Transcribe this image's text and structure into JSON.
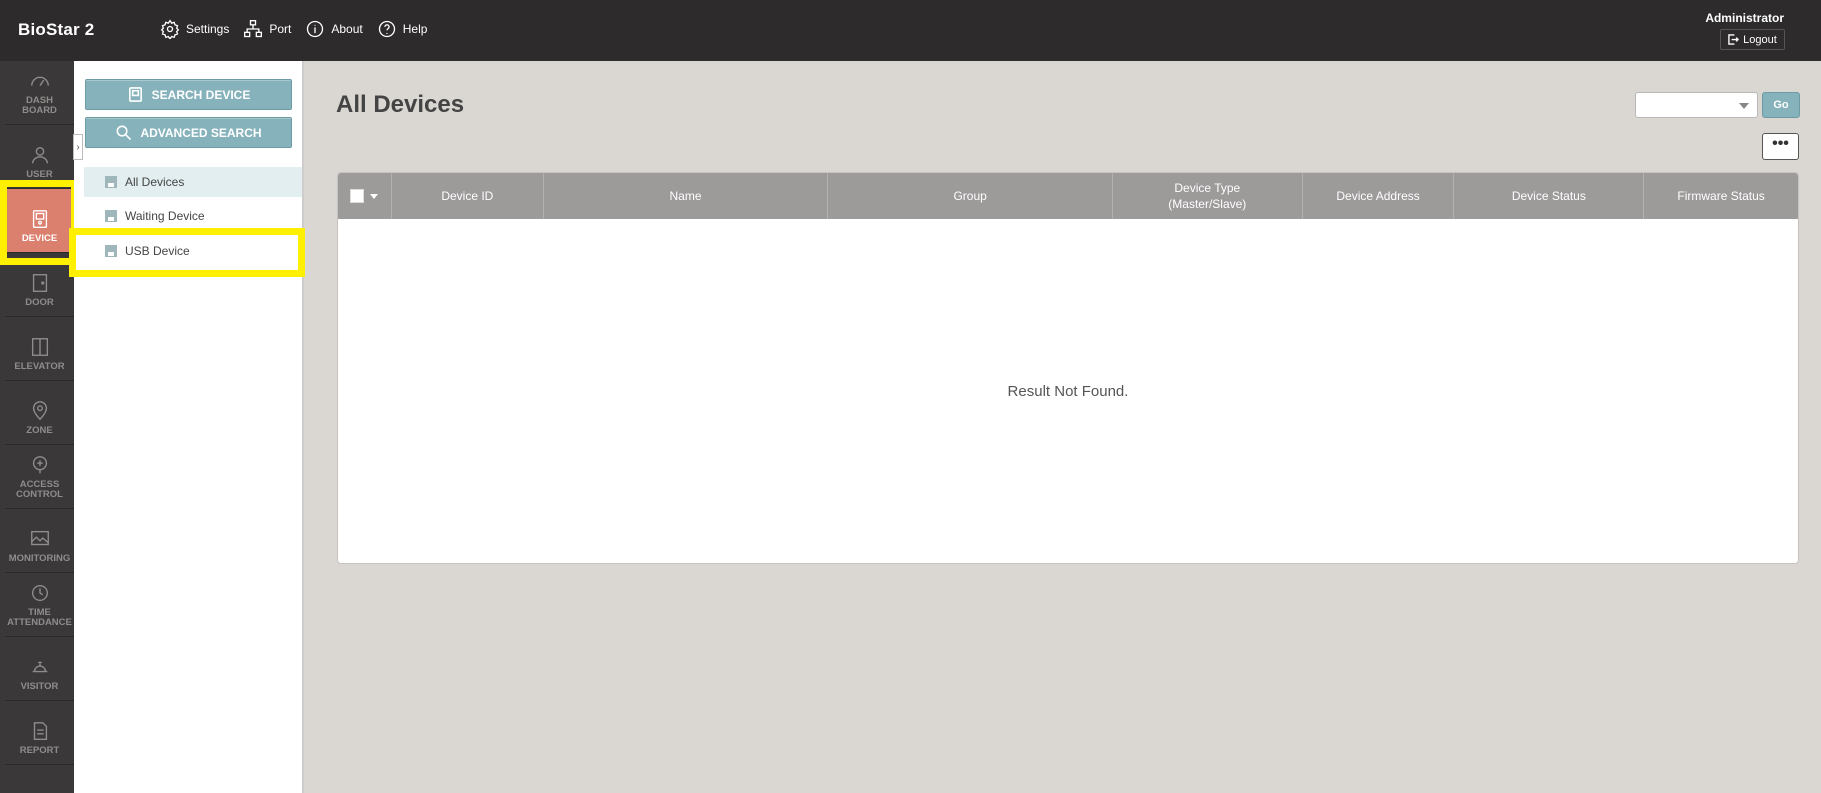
{
  "app": {
    "title": "BioStar 2"
  },
  "topnav": [
    {
      "label": "Settings",
      "icon": "gear-icon"
    },
    {
      "label": "Port",
      "icon": "network-icon"
    },
    {
      "label": "About",
      "icon": "info-icon"
    },
    {
      "label": "Help",
      "icon": "help-icon"
    }
  ],
  "user": {
    "name": "Administrator",
    "logout_label": "Logout"
  },
  "rail": [
    {
      "label": "DASH\nBOARD",
      "icon": "gauge-icon"
    },
    {
      "label": "USER",
      "icon": "user-icon"
    },
    {
      "label": "DEVICE",
      "icon": "device-icon",
      "active": true
    },
    {
      "label": "DOOR",
      "icon": "door-icon"
    },
    {
      "label": "ELEVATOR",
      "icon": "elevator-icon"
    },
    {
      "label": "ZONE",
      "icon": "map-pin-icon"
    },
    {
      "label": "ACCESS\nCONTROL",
      "icon": "access-icon"
    },
    {
      "label": "MONITORING",
      "icon": "monitor-icon"
    },
    {
      "label": "TIME\nATTENDANCE",
      "icon": "clock-icon"
    },
    {
      "label": "VISITOR",
      "icon": "bell-icon"
    },
    {
      "label": "REPORT",
      "icon": "report-icon"
    }
  ],
  "subbar": {
    "search_device": "SEARCH DEVICE",
    "advanced_search": "ADVANCED SEARCH",
    "tree": [
      "All Devices",
      "Waiting Device",
      "USB Device"
    ]
  },
  "main": {
    "title": "All Devices",
    "go_label": "Go",
    "more_label": "•••",
    "columns": [
      "Device ID",
      "Name",
      "Group",
      "Device Type\n(Master/Slave)",
      "Device Address",
      "Device Status",
      "Firmware Status"
    ],
    "empty_message": "Result Not Found."
  },
  "colors": {
    "topbar": "#2d2b2b",
    "rail": "#3a3838",
    "active": "#db7f6f",
    "accent": "#86b2bb",
    "highlight": "#ffef00"
  }
}
